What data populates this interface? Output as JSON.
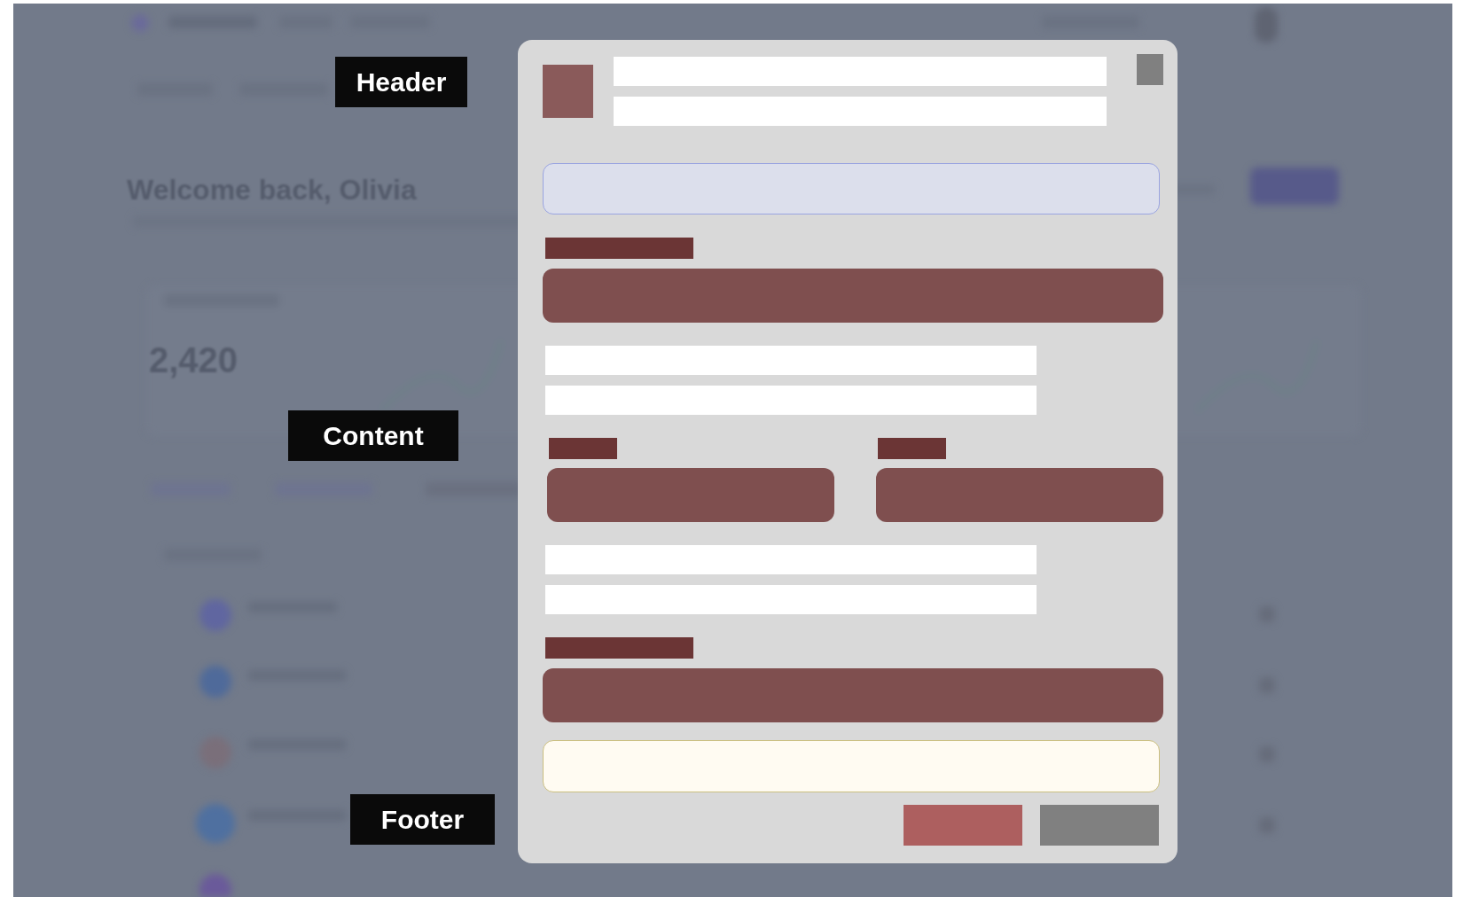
{
  "background": {
    "heading": "Welcome back, Olivia",
    "stat_value": "2,420"
  },
  "annotations": [
    {
      "label": "Header",
      "kind": "header"
    },
    {
      "label": "Content",
      "kind": "content"
    },
    {
      "label": "Footer",
      "kind": "footer"
    }
  ],
  "modal": {
    "content": [
      {
        "kind": "search"
      },
      {
        "kind": "field"
      },
      {
        "kind": "lines"
      },
      {
        "kind": "field_pair"
      },
      {
        "kind": "lines"
      },
      {
        "kind": "field"
      },
      {
        "kind": "notice"
      }
    ]
  }
}
